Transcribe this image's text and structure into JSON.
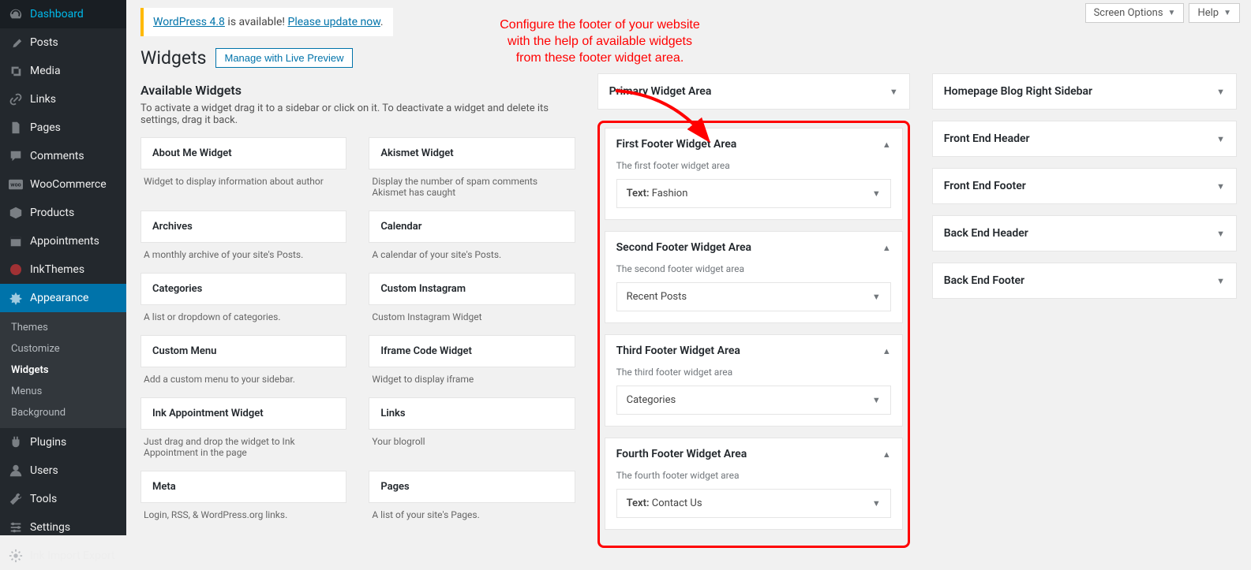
{
  "top_buttons": {
    "screen_options": "Screen Options",
    "help": "Help"
  },
  "update_nag": {
    "prefix": "WordPress 4.8",
    "mid": " is available! ",
    "link": "Please update now"
  },
  "heading": "Widgets",
  "preview_button": "Manage with Live Preview",
  "available": {
    "title": "Available Widgets",
    "description": "To activate a widget drag it to a sidebar or click on it. To deactivate a widget and delete its settings, drag it back.",
    "items": [
      {
        "title": "About Me Widget",
        "desc": "Widget to display information about author"
      },
      {
        "title": "Akismet Widget",
        "desc": "Display the number of spam comments Akismet has caught"
      },
      {
        "title": "Archives",
        "desc": "A monthly archive of your site's Posts."
      },
      {
        "title": "Calendar",
        "desc": "A calendar of your site's Posts."
      },
      {
        "title": "Categories",
        "desc": "A list or dropdown of categories."
      },
      {
        "title": "Custom Instagram",
        "desc": "Custom Instagram Widget"
      },
      {
        "title": "Custom Menu",
        "desc": "Add a custom menu to your sidebar."
      },
      {
        "title": "Iframe Code Widget",
        "desc": "Widget to display iframe"
      },
      {
        "title": "Ink Appointment Widget",
        "desc": "Just drag and drop the widget to Ink Appointment in the page"
      },
      {
        "title": "Links",
        "desc": "Your blogroll"
      },
      {
        "title": "Meta",
        "desc": "Login, RSS, & WordPress.org links."
      },
      {
        "title": "Pages",
        "desc": "A list of your site's Pages."
      }
    ]
  },
  "sidebar_menu": [
    {
      "icon": "dashboard-icon",
      "label": "Dashboard"
    },
    {
      "icon": "pin-icon",
      "label": "Posts"
    },
    {
      "icon": "media-icon",
      "label": "Media"
    },
    {
      "icon": "link-icon",
      "label": "Links"
    },
    {
      "icon": "page-icon",
      "label": "Pages"
    },
    {
      "icon": "comment-icon",
      "label": "Comments"
    },
    {
      "icon": "woo-icon",
      "label": "WooCommerce"
    },
    {
      "icon": "products-icon",
      "label": "Products"
    },
    {
      "icon": "calendar-icon",
      "label": "Appointments"
    },
    {
      "icon": "inkthemes-icon",
      "label": "InkThemes"
    },
    {
      "icon": "appearance-icon",
      "label": "Appearance",
      "current": true
    },
    {
      "icon": "plugins-icon",
      "label": "Plugins"
    },
    {
      "icon": "users-icon",
      "label": "Users"
    },
    {
      "icon": "tools-icon",
      "label": "Tools"
    },
    {
      "icon": "settings-icon",
      "label": "Settings"
    },
    {
      "icon": "import-icon",
      "label": "Ink Import Export"
    }
  ],
  "appearance_submenu": [
    {
      "label": "Themes"
    },
    {
      "label": "Customize"
    },
    {
      "label": "Widgets",
      "current": true
    },
    {
      "label": "Menus"
    },
    {
      "label": "Background"
    }
  ],
  "primary_area": {
    "title": "Primary Widget Area"
  },
  "footer_areas": [
    {
      "title": "First Footer Widget Area",
      "desc": "The first footer widget area",
      "widget_prefix": "Text:",
      "widget_name": " Fashion"
    },
    {
      "title": "Second Footer Widget Area",
      "desc": "The second footer widget area",
      "widget_prefix": "",
      "widget_name": "Recent Posts"
    },
    {
      "title": "Third Footer Widget Area",
      "desc": "The third footer widget area",
      "widget_prefix": "",
      "widget_name": "Categories"
    },
    {
      "title": "Fourth Footer Widget Area",
      "desc": "The fourth footer widget area",
      "widget_prefix": "Text:",
      "widget_name": " Contact Us"
    }
  ],
  "right_areas": [
    {
      "title": "Homepage Blog Right Sidebar"
    },
    {
      "title": "Front End Header"
    },
    {
      "title": "Front End Footer"
    },
    {
      "title": "Back End Header"
    },
    {
      "title": "Back End Footer"
    }
  ],
  "annotation": "Configure the footer of your website with the help of available widgets from these footer widget area."
}
